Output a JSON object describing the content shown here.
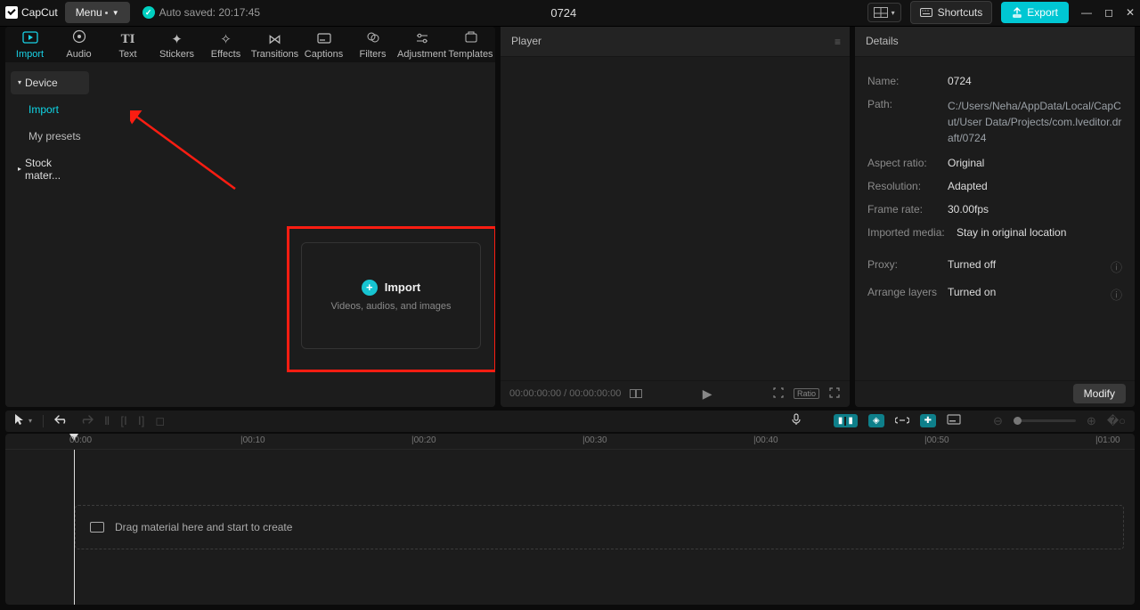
{
  "titlebar": {
    "appname": "CapCut",
    "menu_label": "Menu",
    "autosave_label": "Auto saved: 20:17:45",
    "project_title": "0724",
    "shortcuts_label": "Shortcuts",
    "export_label": "Export"
  },
  "tabs": {
    "import": "Import",
    "audio": "Audio",
    "text": "Text",
    "stickers": "Stickers",
    "effects": "Effects",
    "transitions": "Transitions",
    "captions": "Captions",
    "filters": "Filters",
    "adjustment": "Adjustment",
    "templates": "Templates"
  },
  "sidebar": {
    "device": "Device",
    "import": "Import",
    "presets": "My presets",
    "stock": "Stock mater..."
  },
  "importbox": {
    "title": "Import",
    "sub": "Videos, audios, and images"
  },
  "player": {
    "title": "Player",
    "timecode": "00:00:00:00 / 00:00:00:00",
    "ratio_label": "Ratio"
  },
  "details": {
    "title": "Details",
    "name_label": "Name:",
    "name_value": "0724",
    "path_label": "Path:",
    "path_value": "C:/Users/Neha/AppData/Local/CapCut/User Data/Projects/com.lveditor.draft/0724",
    "aspect_label": "Aspect ratio:",
    "aspect_value": "Original",
    "res_label": "Resolution:",
    "res_value": "Adapted",
    "fps_label": "Frame rate:",
    "fps_value": "30.00fps",
    "media_label": "Imported media:",
    "media_value": "Stay in original location",
    "proxy_label": "Proxy:",
    "proxy_value": "Turned off",
    "layers_label": "Arrange layers",
    "layers_value": "Turned on",
    "modify": "Modify"
  },
  "timeline": {
    "marks": [
      "00:00",
      "|00:10",
      "|00:20",
      "|00:30",
      "|00:40",
      "|00:50",
      "|01:00"
    ],
    "dropzone": "Drag material here and start to create"
  }
}
